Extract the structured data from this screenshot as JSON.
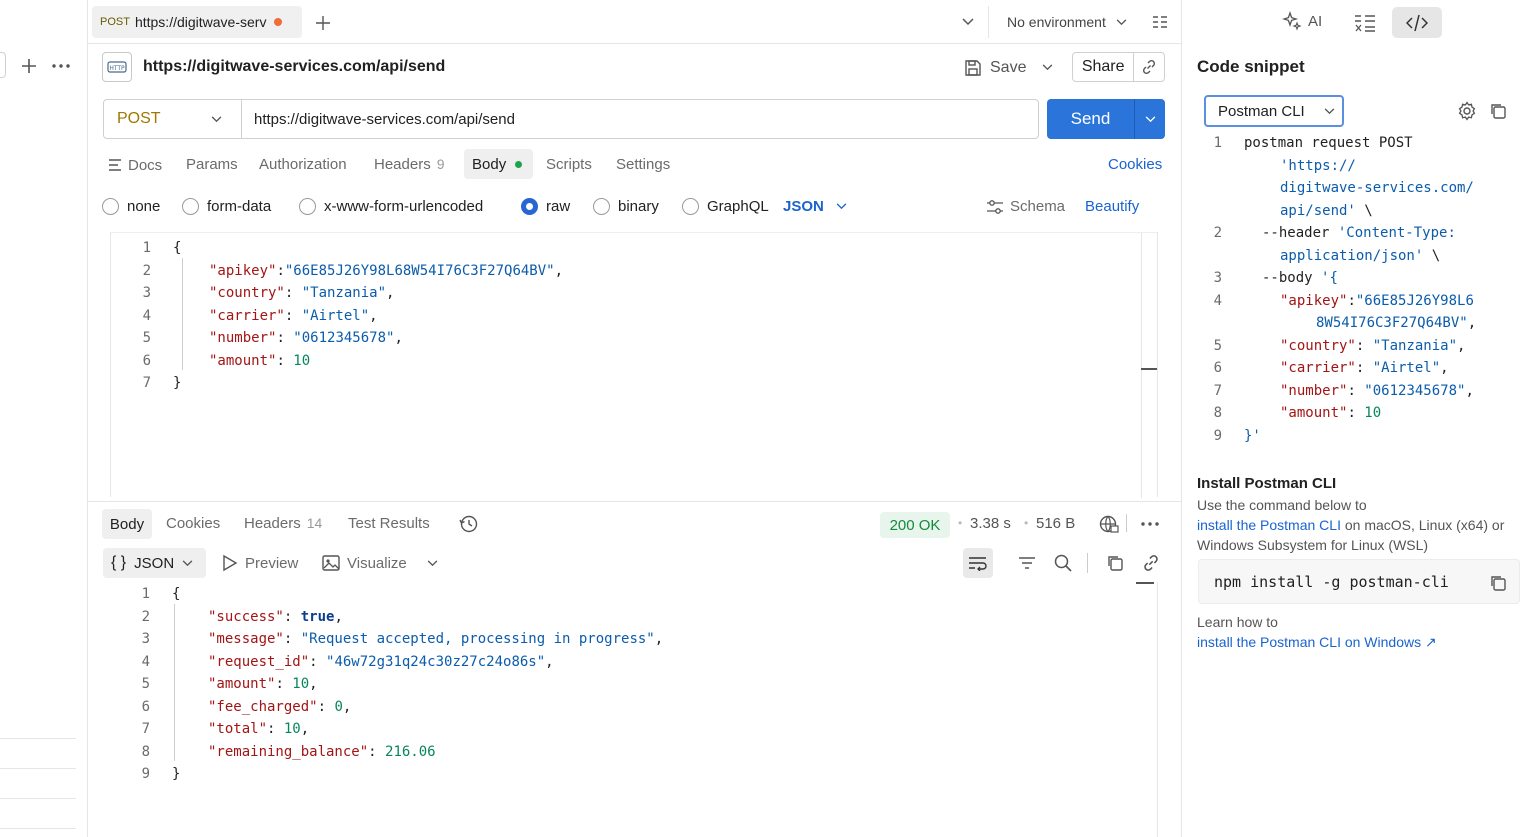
{
  "tab": {
    "method": "POST",
    "title": "https://digitwave-serv"
  },
  "env": {
    "label": "No environment"
  },
  "request": {
    "title": "https://digitwave-services.com/api/send",
    "save_label": "Save",
    "share_label": "Share",
    "method": "POST",
    "url": "https://digitwave-services.com/api/send",
    "send_label": "Send"
  },
  "req_tabs": {
    "docs": "Docs",
    "params": "Params",
    "auth": "Authorization",
    "headers": "Headers",
    "headers_count": "9",
    "body": "Body",
    "scripts": "Scripts",
    "settings": "Settings",
    "cookies": "Cookies"
  },
  "body_types": {
    "none": "none",
    "form_data": "form-data",
    "urlencoded": "x-www-form-urlencoded",
    "raw": "raw",
    "binary": "binary",
    "graphql": "GraphQL",
    "json": "JSON",
    "schema": "Schema",
    "beautify": "Beautify"
  },
  "req_body": {
    "nums": [
      "1",
      "2",
      "3",
      "4",
      "5",
      "6",
      "7"
    ],
    "brace_open": "{",
    "brace_close": "}",
    "apikey_k": "\"apikey\"",
    "apikey_v": "\"66E85J26Y98L68W54I76C3F27Q64BV\"",
    "country_k": "\"country\"",
    "country_v": "\"Tanzania\"",
    "carrier_k": "\"carrier\"",
    "carrier_v": "\"Airtel\"",
    "number_k": "\"number\"",
    "number_v": "\"0612345678\"",
    "amount_k": "\"amount\"",
    "amount_v": "10"
  },
  "resp_tabs": {
    "body": "Body",
    "cookies": "Cookies",
    "headers": "Headers",
    "headers_count": "14",
    "tests": "Test Results"
  },
  "resp_status": {
    "code": "200 OK",
    "time": "3.38 s",
    "size": "516 B"
  },
  "resp_view": {
    "json": "JSON",
    "preview": "Preview",
    "visualize": "Visualize"
  },
  "resp_body": {
    "nums": [
      "1",
      "2",
      "3",
      "4",
      "5",
      "6",
      "7",
      "8",
      "9"
    ],
    "brace_open": "{",
    "brace_close": "}",
    "success_k": "\"success\"",
    "success_v": "true",
    "message_k": "\"message\"",
    "message_v": "\"Request accepted, processing in progress\"",
    "reqid_k": "\"request_id\"",
    "reqid_v": "\"46w72g31q24c30z27c24o86s\"",
    "amount_k": "\"amount\"",
    "amount_v": "10",
    "fee_k": "\"fee_charged\"",
    "fee_v": "0",
    "total_k": "\"total\"",
    "total_v": "10",
    "rem_k": "\"remaining_balance\"",
    "rem_v": "216.06"
  },
  "right": {
    "ai_label": "AI",
    "title": "Code snippet",
    "lang": "Postman CLI",
    "snippet": {
      "n1": "1",
      "n2": "2",
      "n3": "3",
      "n4": "4",
      "n5": "5",
      "n6": "6",
      "n7": "7",
      "n8": "8",
      "n9": "9",
      "l1": "postman request POST",
      "l1b": "'https://",
      "l1c": "digitwave-services.com/",
      "l1d": "api/send'",
      "bs": "\\",
      "l2a": "--header",
      "l2b": "'Content-Type:",
      "l2c": "application/json'",
      "l3a": "--body",
      "l3b": "'{",
      "l4k": "\"apikey\"",
      "l4v": "\"66E85J26Y98L6",
      "l4v2": "8W54I76C3F27Q64BV\"",
      "l5k": "\"country\"",
      "l5v": "\"Tanzania\"",
      "l6k": "\"carrier\"",
      "l6v": "\"Airtel\"",
      "l7k": "\"number\"",
      "l7v": "\"0612345678\"",
      "l8k": "\"amount\"",
      "l8v": "10",
      "l9": "}'"
    },
    "install_title": "Install Postman CLI",
    "install_desc1": "Use the command below to",
    "install_link": "install the Postman CLI",
    "install_desc2": " on macOS, Linux (x64) or",
    "install_desc3": "Windows Subsystem for Linux (WSL)",
    "cmd": "npm install -g postman-cli",
    "learn": "Learn how to",
    "win_link": "install the Postman CLI on Windows ↗"
  }
}
